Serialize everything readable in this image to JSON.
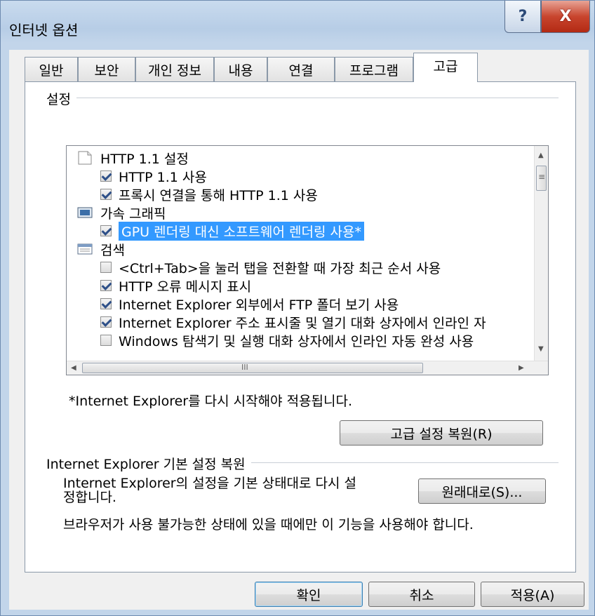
{
  "window": {
    "title": "인터넷 옵션",
    "help_glyph": "?",
    "close_glyph": "X"
  },
  "tabs": [
    {
      "label": "일반"
    },
    {
      "label": "보안"
    },
    {
      "label": "개인 정보"
    },
    {
      "label": "내용"
    },
    {
      "label": "연결"
    },
    {
      "label": "프로그램"
    },
    {
      "label": "고급",
      "active": true
    }
  ],
  "settings": {
    "group_label": "설정",
    "items": [
      {
        "type": "category",
        "icon": "page-icon",
        "label": "HTTP 1.1 설정"
      },
      {
        "type": "checkbox",
        "checked": true,
        "label": "HTTP 1.1 사용"
      },
      {
        "type": "checkbox",
        "checked": true,
        "label": "프록시 연결을 통해 HTTP 1.1 사용"
      },
      {
        "type": "category",
        "icon": "monitor-icon",
        "label": "가속 그래픽"
      },
      {
        "type": "checkbox",
        "checked": true,
        "selected": true,
        "label": "GPU 렌더링 대신 소프트웨어 렌더링 사용*"
      },
      {
        "type": "category",
        "icon": "window-icon",
        "label": "검색"
      },
      {
        "type": "checkbox",
        "checked": false,
        "label": "<Ctrl+Tab>을 눌러 탭을 전환할 때 가장 최근 순서 사용"
      },
      {
        "type": "checkbox",
        "checked": true,
        "label": "HTTP 오류 메시지 표시"
      },
      {
        "type": "checkbox",
        "checked": true,
        "label": "Internet Explorer 외부에서 FTP 폴더 보기 사용"
      },
      {
        "type": "checkbox",
        "checked": true,
        "label": "Internet Explorer 주소 표시줄 및 열기 대화 상자에서 인라인 자"
      },
      {
        "type": "checkbox",
        "checked": false,
        "label": "Windows 탐색기 및 실행 대화 상자에서 인라인 자동 완성 사용"
      }
    ],
    "restart_note": "*Internet Explorer를 다시 시작해야 적용됩니다.",
    "restore_advanced_button": "고급 설정 복원(R)"
  },
  "reset_section": {
    "group_label": "Internet Explorer 기본 설정 복원",
    "description_line1": "Internet Explorer의 설정을 기본 상태대로 다시 설",
    "description_line2": "정합니다.",
    "reset_button": "원래대로(S)...",
    "warning": "브라우저가 사용 불가능한 상태에 있을 때에만 이 기능을 사용해야 합니다."
  },
  "footer": {
    "ok": "확인",
    "cancel": "취소",
    "apply": "적용(A)"
  },
  "scrollbars": {
    "up_glyph": "▲",
    "down_glyph": "▼",
    "left_glyph": "◀",
    "right_glyph": "▶",
    "grip_glyph": "III",
    "vgrip_glyph": "≡"
  },
  "colors": {
    "selection": "#3399ff",
    "close_button": "#c8452e"
  }
}
